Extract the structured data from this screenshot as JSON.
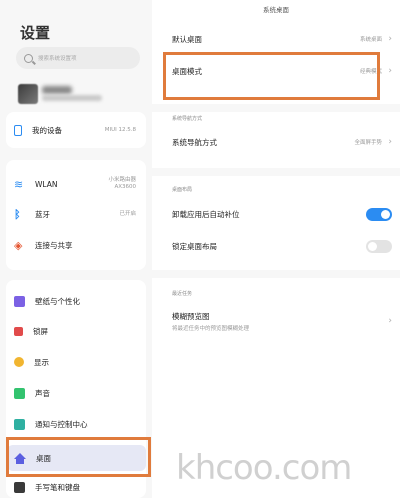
{
  "left": {
    "title": "设置",
    "search": {
      "placeholder": "搜索系统设置项"
    },
    "items": [
      {
        "label": "我的设备",
        "value": "MIUI 12.5.8",
        "icon": "device-icon"
      },
      {
        "label": "WLAN",
        "value": "小米路由器\nAX3600",
        "icon": "wifi-icon"
      },
      {
        "label": "蓝牙",
        "value": "已开启",
        "icon": "bluetooth-icon"
      },
      {
        "label": "连接与共享",
        "value": "",
        "icon": "share-icon"
      },
      {
        "label": "壁纸与个性化",
        "value": "",
        "icon": "wallpaper-icon"
      },
      {
        "label": "锁屏",
        "value": "",
        "icon": "lock-icon"
      },
      {
        "label": "显示",
        "value": "",
        "icon": "display-icon"
      },
      {
        "label": "声音",
        "value": "",
        "icon": "sound-icon"
      },
      {
        "label": "通知与控制中心",
        "value": "",
        "icon": "notification-icon"
      },
      {
        "label": "桌面",
        "value": "",
        "icon": "home-icon"
      },
      {
        "label": "手写笔和键盘",
        "value": "",
        "icon": "keyboard-icon"
      }
    ]
  },
  "right": {
    "title": "系统桌面",
    "default_desktop": {
      "label": "默认桌面",
      "value": "系统桌面"
    },
    "desktop_mode": {
      "label": "桌面模式",
      "value": "经典模式"
    },
    "nav_section": "系统导航方式",
    "nav_method": {
      "label": "系统导航方式",
      "value": "全面屏手势"
    },
    "layout_section": "桌面布局",
    "auto_fill": {
      "label": "卸载应用后自动补位",
      "state": "on"
    },
    "lock_layout": {
      "label": "锁定桌面布局",
      "state": "off"
    },
    "recent_section": "最近任务",
    "blur_preview": {
      "label": "模糊预览图",
      "sub": "将最近任务中的预览图模糊处理"
    }
  },
  "watermark": "khcoo.com",
  "colors": {
    "accent": "#2b8cf2",
    "highlight_box": "#e07b3c",
    "selected_bg": "#e6e8f5"
  }
}
